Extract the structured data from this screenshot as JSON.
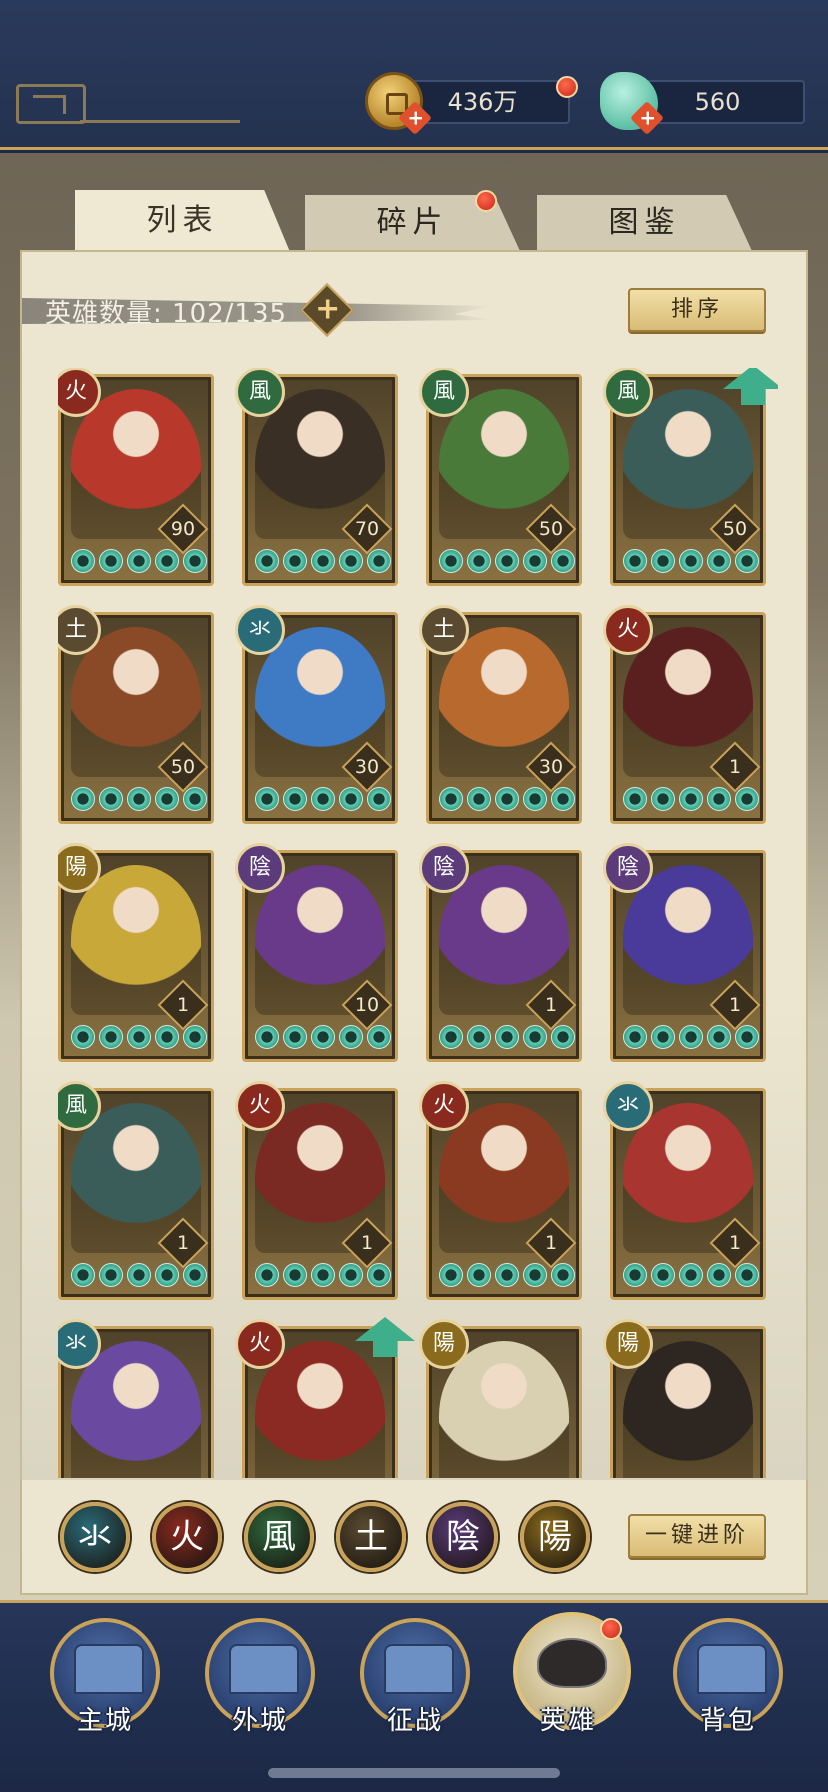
{
  "currencies": {
    "gold": {
      "value": "436万",
      "icon": "copper-coin-icon"
    },
    "jade": {
      "value": "560",
      "icon": "jade-shell-icon"
    }
  },
  "tabs": [
    {
      "label": "列表",
      "active": true
    },
    {
      "label": "碎片",
      "active": false,
      "badge": true
    },
    {
      "label": "图鉴",
      "active": false
    }
  ],
  "hero_count": {
    "label": "英雄数量: 102/135"
  },
  "sort_button": "排序",
  "advance_button": "一键进阶",
  "elements": {
    "water": {
      "glyph": "氺",
      "color": "#2a6b78"
    },
    "fire": {
      "glyph": "火",
      "color": "#8a2a1f"
    },
    "wind": {
      "glyph": "風",
      "color": "#2f6b3f"
    },
    "earth": {
      "glyph": "土",
      "color": "#5a4a30"
    },
    "yin": {
      "glyph": "陰",
      "color": "#5b3b7a"
    },
    "yang": {
      "glyph": "陽",
      "color": "#8a6a1c"
    }
  },
  "heroes": [
    {
      "element": "fire",
      "level": "90",
      "upgrade": false,
      "tint": "#b8392b"
    },
    {
      "element": "wind",
      "level": "70",
      "upgrade": false,
      "tint": "#3a2f25"
    },
    {
      "element": "wind",
      "level": "50",
      "upgrade": false,
      "tint": "#4a7a3a"
    },
    {
      "element": "wind",
      "level": "50",
      "upgrade": true,
      "tint": "#3b5d5a"
    },
    {
      "element": "earth",
      "level": "50",
      "upgrade": false,
      "tint": "#8a4a28"
    },
    {
      "element": "water",
      "level": "30",
      "upgrade": false,
      "tint": "#3f7ac4"
    },
    {
      "element": "earth",
      "level": "30",
      "upgrade": false,
      "tint": "#b86a2e"
    },
    {
      "element": "fire",
      "level": "1",
      "upgrade": false,
      "tint": "#5a2020"
    },
    {
      "element": "yang",
      "level": "1",
      "upgrade": false,
      "tint": "#c9a83a"
    },
    {
      "element": "yin",
      "level": "10",
      "upgrade": false,
      "tint": "#6a3a8a"
    },
    {
      "element": "yin",
      "level": "1",
      "upgrade": false,
      "tint": "#6a3a8a"
    },
    {
      "element": "yin",
      "level": "1",
      "upgrade": false,
      "tint": "#4a3a9a"
    },
    {
      "element": "wind",
      "level": "1",
      "upgrade": false,
      "tint": "#3b5d5a"
    },
    {
      "element": "fire",
      "level": "1",
      "upgrade": false,
      "tint": "#7a2a22"
    },
    {
      "element": "fire",
      "level": "1",
      "upgrade": false,
      "tint": "#8a3a20"
    },
    {
      "element": "water",
      "level": "1",
      "upgrade": false,
      "tint": "#a8352f"
    },
    {
      "element": "water",
      "level": "",
      "upgrade": false,
      "tint": "#6a4aa0"
    },
    {
      "element": "fire",
      "level": "",
      "upgrade": true,
      "tint": "#8a2a22"
    },
    {
      "element": "yang",
      "level": "",
      "upgrade": false,
      "tint": "#d8d0b0"
    },
    {
      "element": "yang",
      "level": "",
      "upgrade": false,
      "tint": "#2e2620"
    }
  ],
  "filters": [
    "water",
    "fire",
    "wind",
    "earth",
    "yin",
    "yang"
  ],
  "bottom_nav": [
    {
      "label": "主城",
      "icon": "main-city-icon",
      "active": false
    },
    {
      "label": "外城",
      "icon": "outer-city-icon",
      "active": false
    },
    {
      "label": "征战",
      "icon": "campaign-icon",
      "active": false
    },
    {
      "label": "英雄",
      "icon": "hero-icon",
      "active": true,
      "badge": true
    },
    {
      "label": "背包",
      "icon": "backpack-icon",
      "active": false
    }
  ]
}
